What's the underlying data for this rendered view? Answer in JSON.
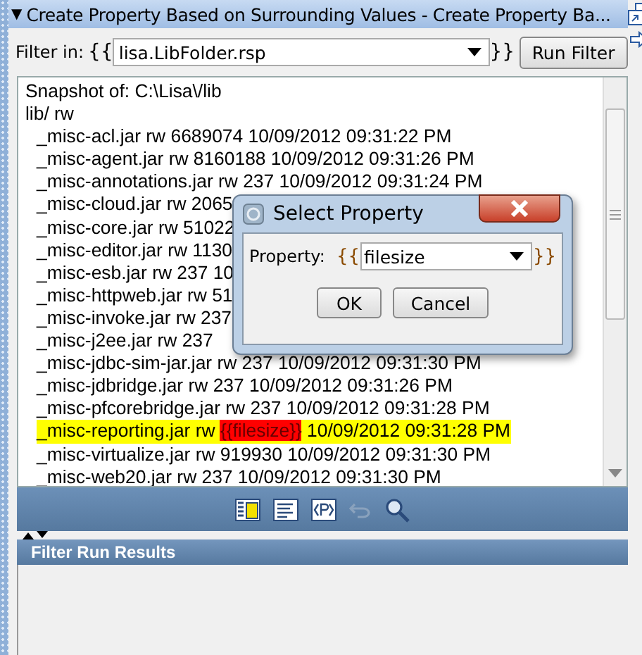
{
  "panel": {
    "title": "Create Property Based on Surrounding Values - Create Property Ba...",
    "collapse_glyph": "▼"
  },
  "filter": {
    "label": "Filter in:",
    "open_braces": "{{",
    "value": "lisa.LibFolder.rsp",
    "close_braces": "}}",
    "button": "Run Filter"
  },
  "snapshot": "Snapshot of: C:\\Lisa\\/lib",
  "folder": {
    "text": "lib/ rw",
    "children": [
      {
        "text": "_misc-acl.jar rw 6689074 10/09/2012 09:31:22 PM",
        "highlight": false
      },
      {
        "text": "_misc-agent.jar rw 8160188 10/09/2012 09:31:26 PM",
        "highlight": false
      },
      {
        "text": "_misc-annotations.jar rw 237 10/09/2012 09:31:24 PM",
        "highlight": false
      },
      {
        "text": "_misc-cloud.jar rw 2065",
        "highlight": false
      },
      {
        "text": "_misc-core.jar rw 51022",
        "highlight": false
      },
      {
        "text": "_misc-editor.jar rw 1130",
        "highlight": false
      },
      {
        "text": "_misc-esb.jar rw 237 10",
        "highlight": false
      },
      {
        "text": "_misc-httpweb.jar rw 51",
        "highlight": false
      },
      {
        "text": "_misc-invoke.jar rw 237",
        "highlight": false
      },
      {
        "text": "_misc-j2ee.jar rw 237",
        "highlight": false
      },
      {
        "text": "_misc-jdbc-sim-jar.jar rw 237 10/09/2012 09:31:30 PM",
        "highlight": false
      },
      {
        "text": "_misc-jdbridge.jar rw 237 10/09/2012 09:31:26 PM",
        "highlight": false
      },
      {
        "text": "_misc-pfcorebridge.jar rw 237 10/09/2012 09:31:28 PM",
        "highlight": false
      },
      {
        "text": "_misc-reporting.jar rw ",
        "token": "{{filesize}}",
        "text_after": " 10/09/2012 09:31:28 PM",
        "highlight": true
      },
      {
        "text": "_misc-virtualize.jar rw 919930 10/09/2012 09:31:30 PM",
        "highlight": false
      },
      {
        "text": "_misc-web20.jar rw 237 10/09/2012 09:31:30 PM",
        "highlight": false
      }
    ]
  },
  "results": {
    "title": "Filter Run Results"
  },
  "dialog": {
    "title": "Select Property",
    "label": "Property:",
    "open_braces": "{{",
    "value": "filesize",
    "close_braces": "}}",
    "buttons": [
      "OK",
      "Cancel"
    ]
  }
}
